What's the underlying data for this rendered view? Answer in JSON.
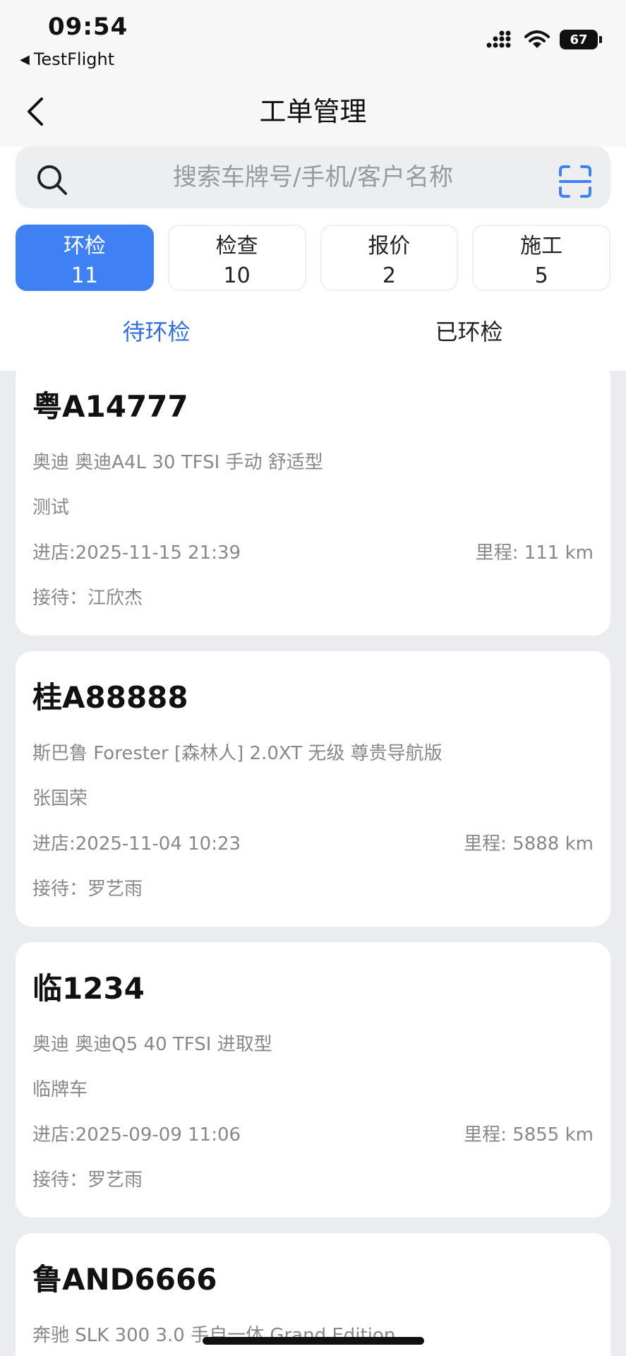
{
  "status_bar": {
    "time": "09:54",
    "back_app": "TestFlight",
    "battery": "67"
  },
  "nav": {
    "title": "工单管理"
  },
  "search": {
    "placeholder": "搜索车牌号/手机/客户名称"
  },
  "stats": [
    {
      "label": "环检",
      "count": "11",
      "active": true
    },
    {
      "label": "检查",
      "count": "10",
      "active": false
    },
    {
      "label": "报价",
      "count": "2",
      "active": false
    },
    {
      "label": "施工",
      "count": "5",
      "active": false
    }
  ],
  "subtabs": [
    {
      "label": "待环检",
      "active": true
    },
    {
      "label": "已环检",
      "active": false
    }
  ],
  "orders": [
    {
      "plate": "粤A14777",
      "model": "奥迪 奥迪A4L 30 TFSI 手动 舒适型",
      "customer": "测试",
      "entry": "进店:2025-11-15 21:39",
      "mileage": "里程: 111 km",
      "reception": "接待：江欣杰"
    },
    {
      "plate": "桂A88888",
      "model": "斯巴鲁 Forester [森林人] 2.0XT 无级 尊贵导航版",
      "customer": "张国荣",
      "entry": "进店:2025-11-04 10:23",
      "mileage": "里程: 5888 km",
      "reception": "接待：罗艺雨"
    },
    {
      "plate": "临1234",
      "model": "奥迪 奥迪Q5 40 TFSI 进取型",
      "customer": "临牌车",
      "entry": "进店:2025-09-09 11:06",
      "mileage": "里程: 5855 km",
      "reception": "接待：罗艺雨"
    },
    {
      "plate": "鲁AND6666",
      "model": "奔驰 SLK 300 3.0 手自一体 Grand Edition",
      "customer": "",
      "entry": "",
      "mileage": "",
      "reception": ""
    }
  ],
  "colors": {
    "accent": "#4080f5",
    "subtab_active": "#2f6fe0",
    "secondary_text": "#888888"
  }
}
